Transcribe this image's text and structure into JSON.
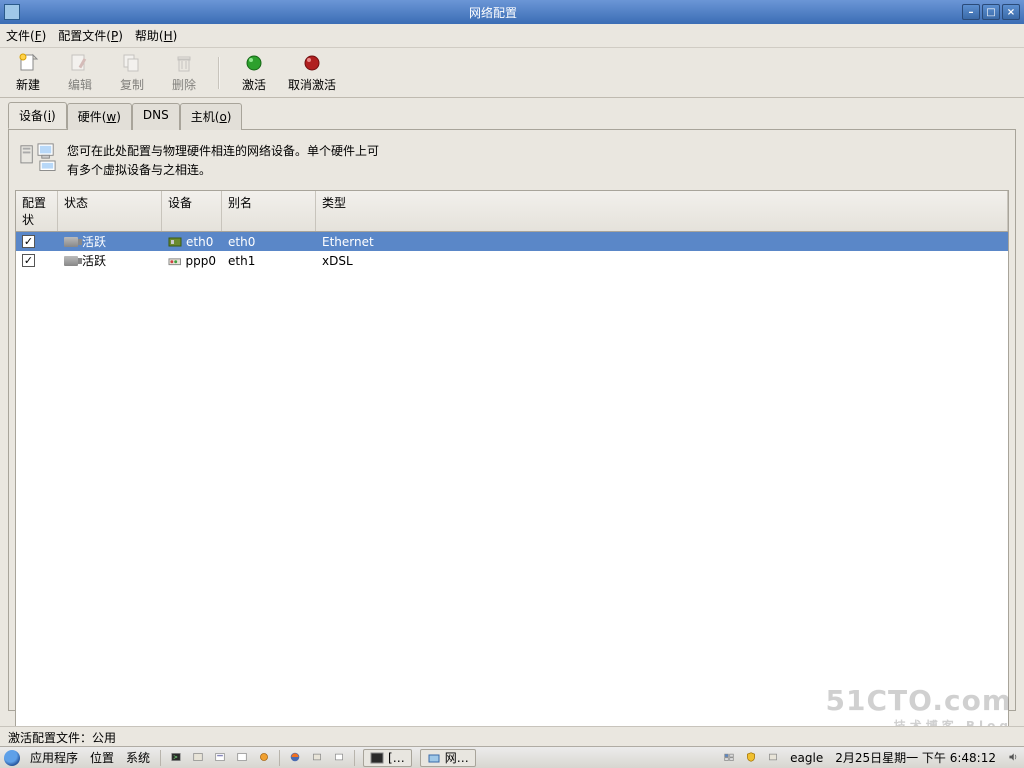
{
  "window": {
    "title": "网络配置"
  },
  "menubar": {
    "file": "文件(F)",
    "profile": "配置文件(P)",
    "help": "帮助(H)"
  },
  "toolbar": {
    "new": "新建",
    "edit": "编辑",
    "copy": "复制",
    "delete": "删除",
    "activate": "激活",
    "deactivate": "取消激活"
  },
  "tabs": {
    "devices": "设备(i)",
    "hardware": "硬件(w)",
    "dns": "DNS",
    "hosts": "主机(o)"
  },
  "info": {
    "line1": "您可在此处配置与物理硬件相连的网络设备。单个硬件上可",
    "line2": "有多个虚拟设备与之相连。"
  },
  "columns": {
    "config": "配置状",
    "status": "状态",
    "device": "设备",
    "alias": "别名",
    "type": "类型"
  },
  "rows": [
    {
      "checked": true,
      "status": "活跃",
      "device": "eth0",
      "alias": "eth0",
      "type": "Ethernet",
      "selected": true,
      "dev_icon": "nic"
    },
    {
      "checked": true,
      "status": "活跃",
      "device": "ppp0",
      "alias": "eth1",
      "type": "xDSL",
      "selected": false,
      "dev_icon": "modem"
    }
  ],
  "statusbar": {
    "text": "激活配置文件：公用"
  },
  "taskbar": {
    "apps": "应用程序",
    "places": "位置",
    "system": "系统",
    "task1": "[…",
    "task2": "网…",
    "user": "eagle",
    "date": "2月25日星期一 下午 6:48:12"
  },
  "watermark": {
    "main": "51CTO.com",
    "sub": "技术博客 Blog"
  }
}
